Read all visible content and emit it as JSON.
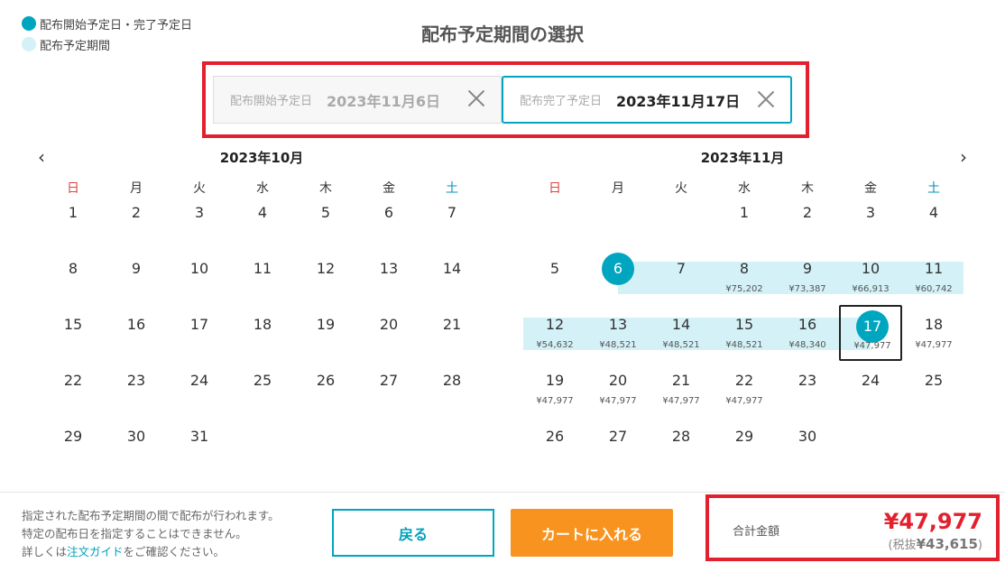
{
  "legend": {
    "item1": "配布開始予定日・完了予定日",
    "item2": "配布予定期間"
  },
  "title": "配布予定期間の選択",
  "start_field": {
    "label": "配布開始予定日",
    "value": "2023年11月6日"
  },
  "end_field": {
    "label": "配布完了予定日",
    "value": "2023年11月17日"
  },
  "nav": {
    "prev": "‹",
    "next": "›"
  },
  "weekdays": [
    "日",
    "月",
    "火",
    "水",
    "木",
    "金",
    "土"
  ],
  "months": [
    {
      "title": "2023年10月",
      "weeks": [
        [
          {
            "d": "1"
          },
          {
            "d": "2"
          },
          {
            "d": "3"
          },
          {
            "d": "4"
          },
          {
            "d": "5"
          },
          {
            "d": "6"
          },
          {
            "d": "7"
          }
        ],
        [
          {
            "d": "8"
          },
          {
            "d": "9"
          },
          {
            "d": "10"
          },
          {
            "d": "11"
          },
          {
            "d": "12"
          },
          {
            "d": "13"
          },
          {
            "d": "14"
          }
        ],
        [
          {
            "d": "15"
          },
          {
            "d": "16"
          },
          {
            "d": "17"
          },
          {
            "d": "18"
          },
          {
            "d": "19"
          },
          {
            "d": "20"
          },
          {
            "d": "21"
          }
        ],
        [
          {
            "d": "22"
          },
          {
            "d": "23"
          },
          {
            "d": "24"
          },
          {
            "d": "25"
          },
          {
            "d": "26"
          },
          {
            "d": "27"
          },
          {
            "d": "28"
          }
        ],
        [
          {
            "d": "29"
          },
          {
            "d": "30"
          },
          {
            "d": "31"
          },
          null,
          null,
          null,
          null
        ]
      ]
    },
    {
      "title": "2023年11月",
      "weeks": [
        [
          null,
          null,
          null,
          {
            "d": "1"
          },
          {
            "d": "2"
          },
          {
            "d": "3"
          },
          {
            "d": "4"
          }
        ],
        [
          {
            "d": "5"
          },
          {
            "d": "6",
            "sel": true
          },
          {
            "d": "7"
          },
          {
            "d": "8",
            "p": "¥75,202"
          },
          {
            "d": "9",
            "p": "¥73,387"
          },
          {
            "d": "10",
            "p": "¥66,913"
          },
          {
            "d": "11",
            "p": "¥60,742"
          }
        ],
        [
          {
            "d": "12",
            "p": "¥54,632"
          },
          {
            "d": "13",
            "p": "¥48,521"
          },
          {
            "d": "14",
            "p": "¥48,521"
          },
          {
            "d": "15",
            "p": "¥48,521"
          },
          {
            "d": "16",
            "p": "¥48,340"
          },
          {
            "d": "17",
            "p": "¥47,977",
            "sel": true,
            "box": true
          },
          {
            "d": "18",
            "p": "¥47,977"
          }
        ],
        [
          {
            "d": "19",
            "p": "¥47,977"
          },
          {
            "d": "20",
            "p": "¥47,977"
          },
          {
            "d": "21",
            "p": "¥47,977"
          },
          {
            "d": "22",
            "p": "¥47,977"
          },
          {
            "d": "23"
          },
          {
            "d": "24"
          },
          {
            "d": "25"
          }
        ],
        [
          {
            "d": "26"
          },
          {
            "d": "27"
          },
          {
            "d": "28"
          },
          {
            "d": "29"
          },
          {
            "d": "30"
          },
          null,
          null
        ]
      ]
    }
  ],
  "footer": {
    "note_line1": "指定された配布予定期間の間で配布が行われます。",
    "note_line2": "特定の配布日を指定することはできません。",
    "note_pre": "詳しくは",
    "note_link": "注文ガイド",
    "note_post": "をご確認ください。",
    "back_button": "戻る",
    "cart_button": "カートに入れる",
    "total_label": "合計金額",
    "total_amount": "¥47,977",
    "tax_open": "(税抜",
    "tax_value": "¥43,615",
    "tax_close": ")"
  },
  "colors": {
    "accent": "#00a6c0",
    "range": "#d3f1f7",
    "cta": "#f7931e",
    "highlight": "#e3202e",
    "price": "#e3202e"
  }
}
